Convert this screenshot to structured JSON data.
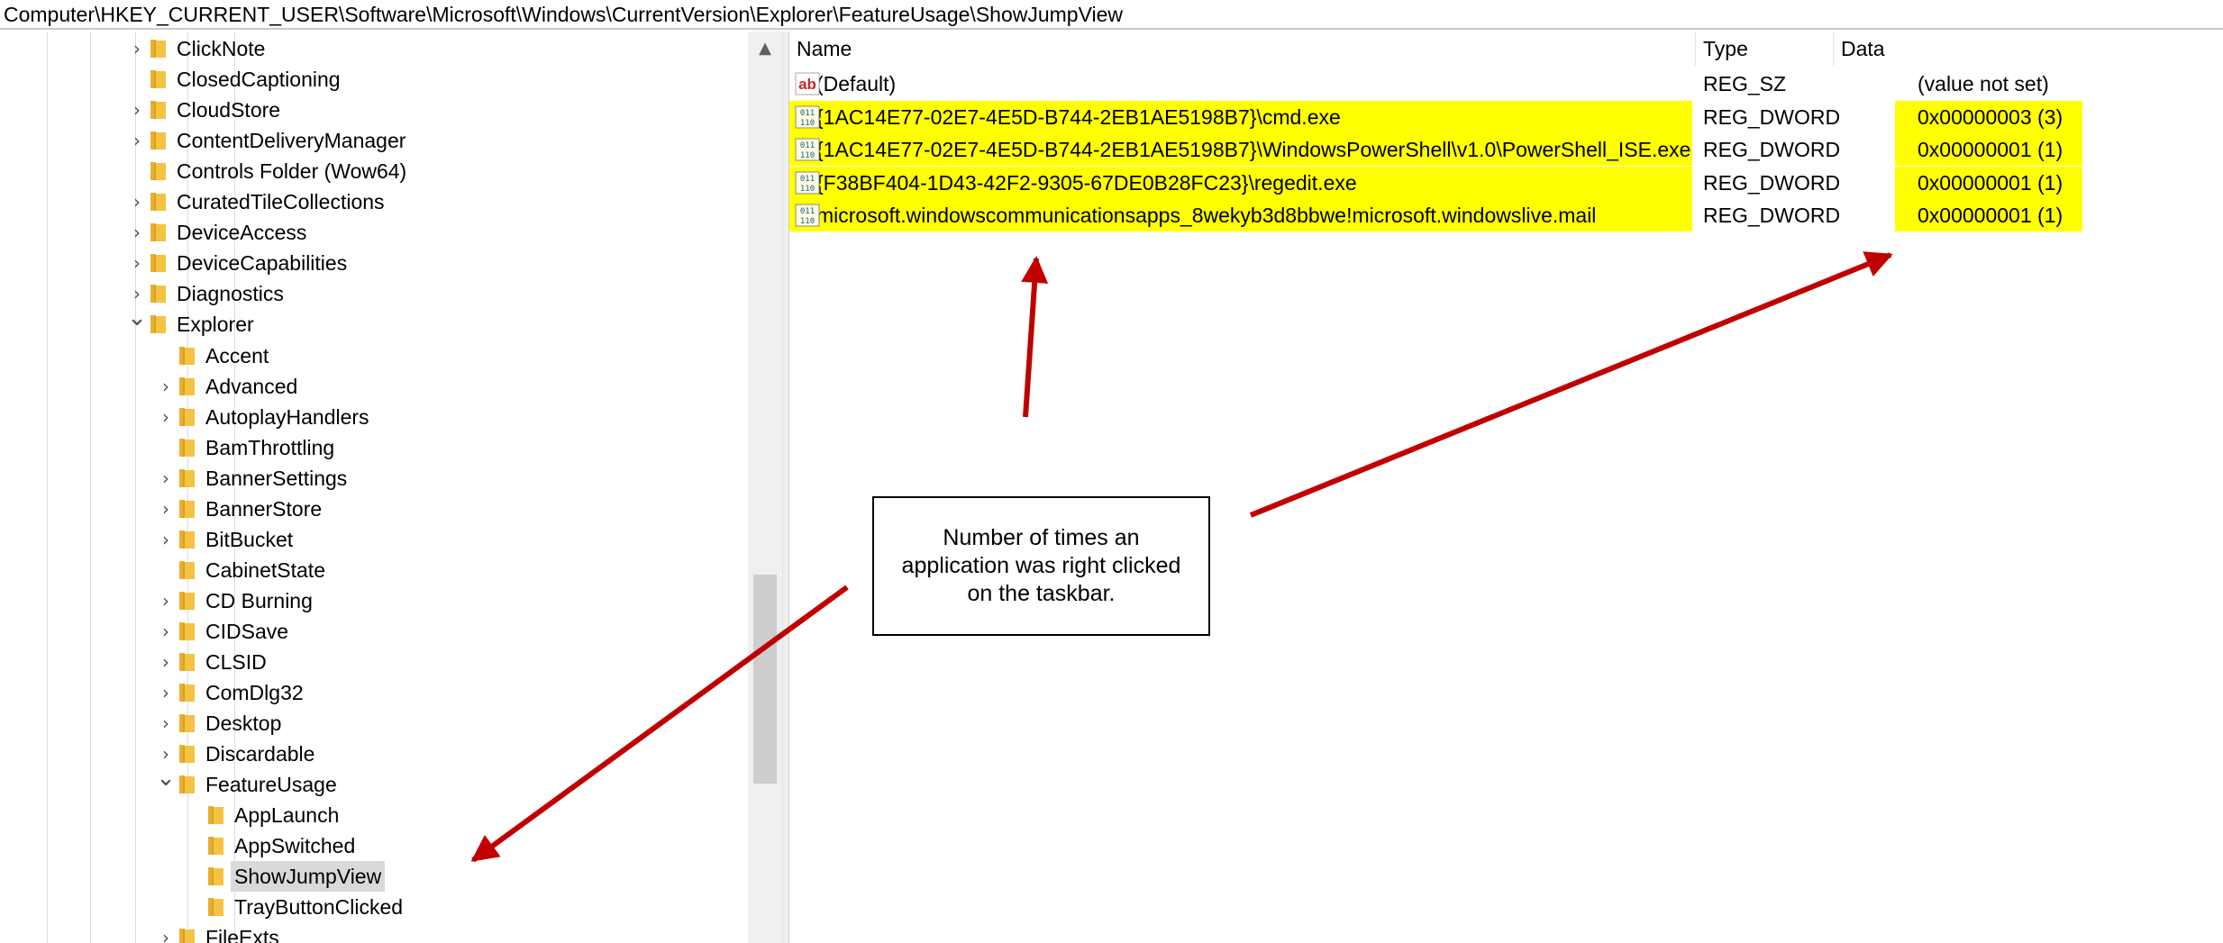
{
  "address": "Computer\\HKEY_CURRENT_USER\\Software\\Microsoft\\Windows\\CurrentVersion\\Explorer\\FeatureUsage\\ShowJumpView",
  "tree": {
    "items": [
      {
        "label": "ClickNote",
        "expander": "collapsed"
      },
      {
        "label": "ClosedCaptioning",
        "expander": "none"
      },
      {
        "label": "CloudStore",
        "expander": "collapsed"
      },
      {
        "label": "ContentDeliveryManager",
        "expander": "collapsed"
      },
      {
        "label": "Controls Folder (Wow64)",
        "expander": "none"
      },
      {
        "label": "CuratedTileCollections",
        "expander": "collapsed"
      },
      {
        "label": "DeviceAccess",
        "expander": "collapsed"
      },
      {
        "label": "DeviceCapabilities",
        "expander": "collapsed"
      },
      {
        "label": "Diagnostics",
        "expander": "collapsed"
      },
      {
        "label": "Explorer",
        "expander": "expanded"
      },
      {
        "label": "Accent",
        "expander": "none"
      },
      {
        "label": "Advanced",
        "expander": "collapsed"
      },
      {
        "label": "AutoplayHandlers",
        "expander": "collapsed"
      },
      {
        "label": "BamThrottling",
        "expander": "none"
      },
      {
        "label": "BannerSettings",
        "expander": "collapsed"
      },
      {
        "label": "BannerStore",
        "expander": "collapsed"
      },
      {
        "label": "BitBucket",
        "expander": "collapsed"
      },
      {
        "label": "CabinetState",
        "expander": "none"
      },
      {
        "label": "CD Burning",
        "expander": "collapsed"
      },
      {
        "label": "CIDSave",
        "expander": "collapsed"
      },
      {
        "label": "CLSID",
        "expander": "collapsed"
      },
      {
        "label": "ComDlg32",
        "expander": "collapsed"
      },
      {
        "label": "Desktop",
        "expander": "collapsed"
      },
      {
        "label": "Discardable",
        "expander": "collapsed"
      },
      {
        "label": "FeatureUsage",
        "expander": "expanded"
      },
      {
        "label": "AppLaunch",
        "expander": "none"
      },
      {
        "label": "AppSwitched",
        "expander": "none"
      },
      {
        "label": "ShowJumpView",
        "expander": "none"
      },
      {
        "label": "TrayButtonClicked",
        "expander": "none"
      },
      {
        "label": "FileExts",
        "expander": "collapsed"
      }
    ],
    "selected": "ShowJumpView"
  },
  "list": {
    "columns": {
      "name": "Name",
      "type": "Type",
      "data": "Data"
    },
    "rows": [
      {
        "name": "(Default)",
        "type": "REG_SZ",
        "data": "(value not set)",
        "icon": "string-value-icon",
        "highlight": false
      },
      {
        "name": "{1AC14E77-02E7-4E5D-B744-2EB1AE5198B7}\\cmd.exe",
        "type": "REG_DWORD",
        "data": "0x00000003 (3)",
        "icon": "dword-value-icon",
        "highlight": true
      },
      {
        "name": "{1AC14E77-02E7-4E5D-B744-2EB1AE5198B7}\\WindowsPowerShell\\v1.0\\PowerShell_ISE.exe",
        "type": "REG_DWORD",
        "data": "0x00000001 (1)",
        "icon": "dword-value-icon",
        "highlight": true
      },
      {
        "name": "{F38BF404-1D43-42F2-9305-67DE0B28FC23}\\regedit.exe",
        "type": "REG_DWORD",
        "data": "0x00000001 (1)",
        "icon": "dword-value-icon",
        "highlight": true
      },
      {
        "name": "microsoft.windowscommunicationsapps_8wekyb3d8bbwe!microsoft.windowslive.mail",
        "type": "REG_DWORD",
        "data": "0x00000001 (1)",
        "icon": "dword-value-icon",
        "highlight": true
      }
    ]
  },
  "callout": {
    "text": "Number of times an application was right clicked on the taskbar."
  },
  "colors": {
    "highlight": "#ffff00",
    "arrow": "#c00000",
    "folder": "#f5c242",
    "selection": "#d9d9d9"
  }
}
